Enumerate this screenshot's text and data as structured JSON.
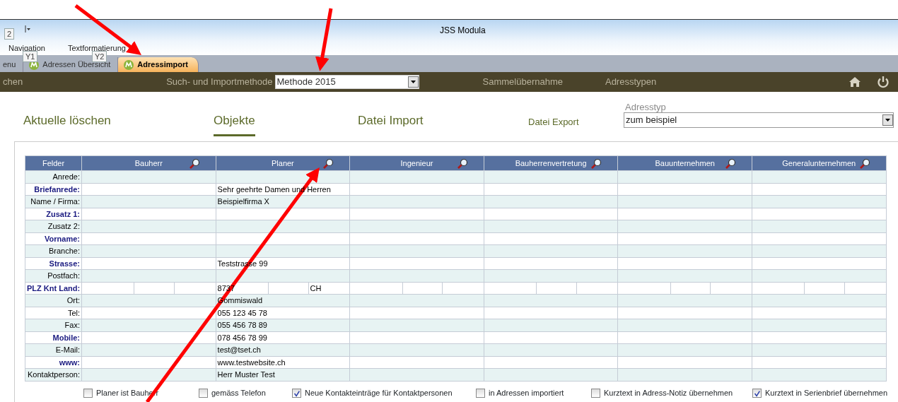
{
  "window": {
    "title": "JSS Modula",
    "quick_access_keytip": "2"
  },
  "ribbon": {
    "groups": [
      {
        "label": "Navigation",
        "keytip": "Y1"
      },
      {
        "label": "Textformatierung",
        "keytip": "Y2"
      }
    ]
  },
  "document_tabs": [
    {
      "label": "enu",
      "has_icon": false,
      "selected": false
    },
    {
      "label": "Adressen Übersicht",
      "has_icon": true,
      "selected": false
    },
    {
      "label": "Adressimport",
      "has_icon": true,
      "selected": true
    }
  ],
  "nav_bar": {
    "left_item": "chen",
    "method_label": "Such- und Importmethode",
    "method_value": "Methode 2015",
    "items": [
      "Sammelübernahme",
      "Adresstypen"
    ]
  },
  "sub_tabs": [
    {
      "label": "Aktuelle löschen",
      "selected": false,
      "kind": "large"
    },
    {
      "label": "Objekte",
      "selected": true,
      "kind": "large"
    },
    {
      "label": "Datei Import",
      "selected": false,
      "kind": "large"
    },
    {
      "label": "Datei Export",
      "selected": false,
      "kind": "small"
    }
  ],
  "address_type": {
    "label": "Adresstyp",
    "value": "zum beispiel"
  },
  "table": {
    "columns": [
      {
        "label": "Felder",
        "searchable": false
      },
      {
        "label": "Bauherr",
        "searchable": true
      },
      {
        "label": "Planer",
        "searchable": true
      },
      {
        "label": "Ingenieur",
        "searchable": true
      },
      {
        "label": "Bauherrenvertretung",
        "searchable": true
      },
      {
        "label": "Bauunternehmen",
        "searchable": true
      },
      {
        "label": "Generalunternehmen",
        "searchable": true
      }
    ],
    "rows": [
      {
        "label": "Anrede:",
        "required": false,
        "kind": "single"
      },
      {
        "label": "Briefanrede:",
        "required": true,
        "kind": "single",
        "planer": "Sehr geehrte Damen und Herren"
      },
      {
        "label": "Name / Firma:",
        "required": false,
        "kind": "single",
        "planer": "Beispielfirma X"
      },
      {
        "label": "Zusatz 1:",
        "required": true,
        "kind": "single"
      },
      {
        "label": "Zusatz 2:",
        "required": false,
        "kind": "single"
      },
      {
        "label": "Vorname:",
        "required": true,
        "kind": "single"
      },
      {
        "label": "Branche:",
        "required": false,
        "kind": "single"
      },
      {
        "label": "Strasse:",
        "required": true,
        "kind": "single",
        "planer": "Teststrasse 99"
      },
      {
        "label": "Postfach:",
        "required": false,
        "kind": "single"
      },
      {
        "label": "PLZ Knt Land:",
        "required": true,
        "kind": "split",
        "planer": {
          "plz": "8737",
          "land": "CH"
        }
      },
      {
        "label": "Ort:",
        "required": false,
        "kind": "single",
        "planer": "Gommiswald"
      },
      {
        "label": "Tel:",
        "required": false,
        "kind": "single",
        "planer": "055 123 45 78"
      },
      {
        "label": "Fax:",
        "required": false,
        "kind": "single",
        "planer": "055 456 78 89"
      },
      {
        "label": "Mobile:",
        "required": true,
        "kind": "single",
        "planer": "078 456 78 99"
      },
      {
        "label": "E-Mail:",
        "required": false,
        "kind": "single",
        "planer": "test@tset.ch"
      },
      {
        "label": "www:",
        "required": true,
        "kind": "single",
        "planer": "www.testwebsite.ch"
      },
      {
        "label": "Kontaktperson:",
        "required": false,
        "kind": "single",
        "planer": "Herr Muster Test"
      }
    ]
  },
  "options": [
    {
      "label": "Planer ist Bauherr",
      "checked": false
    },
    {
      "label": "gemäss Telefon",
      "checked": false
    },
    {
      "label": "Neue Kontakteinträge für Kontaktpersonen",
      "checked": true
    },
    {
      "label": "in Adressen importiert",
      "checked": false
    },
    {
      "label": "Kurztext in Adress-Notiz übernehmen",
      "checked": false
    },
    {
      "label": "Kurztext in Serienbrief übernehmen",
      "checked": true
    }
  ]
}
